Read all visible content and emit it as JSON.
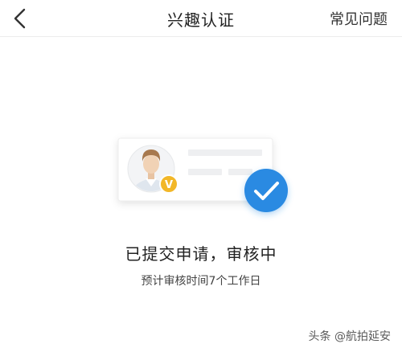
{
  "navbar": {
    "title": "兴趣认证",
    "faq_label": "常见问题"
  },
  "illustration": {
    "badge_letter": "V"
  },
  "status": {
    "title": "已提交申请，审核中",
    "subtitle": "预计审核时间7个工作日"
  },
  "watermark": {
    "text": "头条 @航拍延安"
  },
  "colors": {
    "accent_blue": "#2a8ae2",
    "badge_yellow": "#f2b728"
  }
}
